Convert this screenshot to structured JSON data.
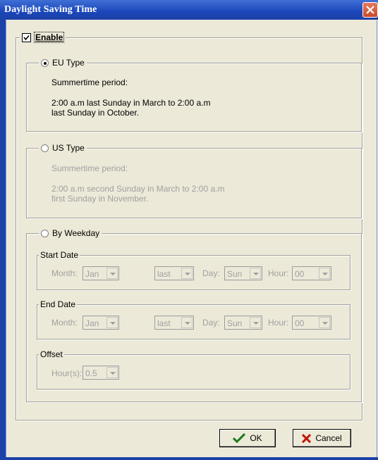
{
  "window": {
    "title": "Daylight Saving Time"
  },
  "enable": {
    "label": "Enable",
    "checked": true
  },
  "eu": {
    "label": "EU Type",
    "selected": true,
    "period_label": "Summertime period:",
    "line1": "2:00 a.m last Sunday in March to  2:00 a.m",
    "line2": "last Sunday in October."
  },
  "us": {
    "label": "US Type",
    "selected": false,
    "period_label": "Summertime period:",
    "line1": "2:00 a.m second Sunday in March to  2:00 a.m",
    "line2": "first Sunday in November."
  },
  "weekday": {
    "label": "By Weekday",
    "selected": false,
    "start": {
      "label": "Start Date",
      "month_label": "Month:",
      "month": "Jan",
      "week": "last",
      "day_label": "Day:",
      "day": "Sun",
      "hour_label": "Hour:",
      "hour": "00"
    },
    "end": {
      "label": "End Date",
      "month_label": "Month:",
      "month": "Jan",
      "week": "last",
      "day_label": "Day:",
      "day": "Sun",
      "hour_label": "Hour:",
      "hour": "00"
    },
    "offset": {
      "label": "Offset",
      "hours_label": "Hour(s):",
      "hours": "0.5"
    }
  },
  "buttons": {
    "ok": "OK",
    "cancel": "Cancel"
  },
  "icons": {
    "ok": "checkmark-icon",
    "cancel": "x-icon",
    "close": "close-icon"
  }
}
